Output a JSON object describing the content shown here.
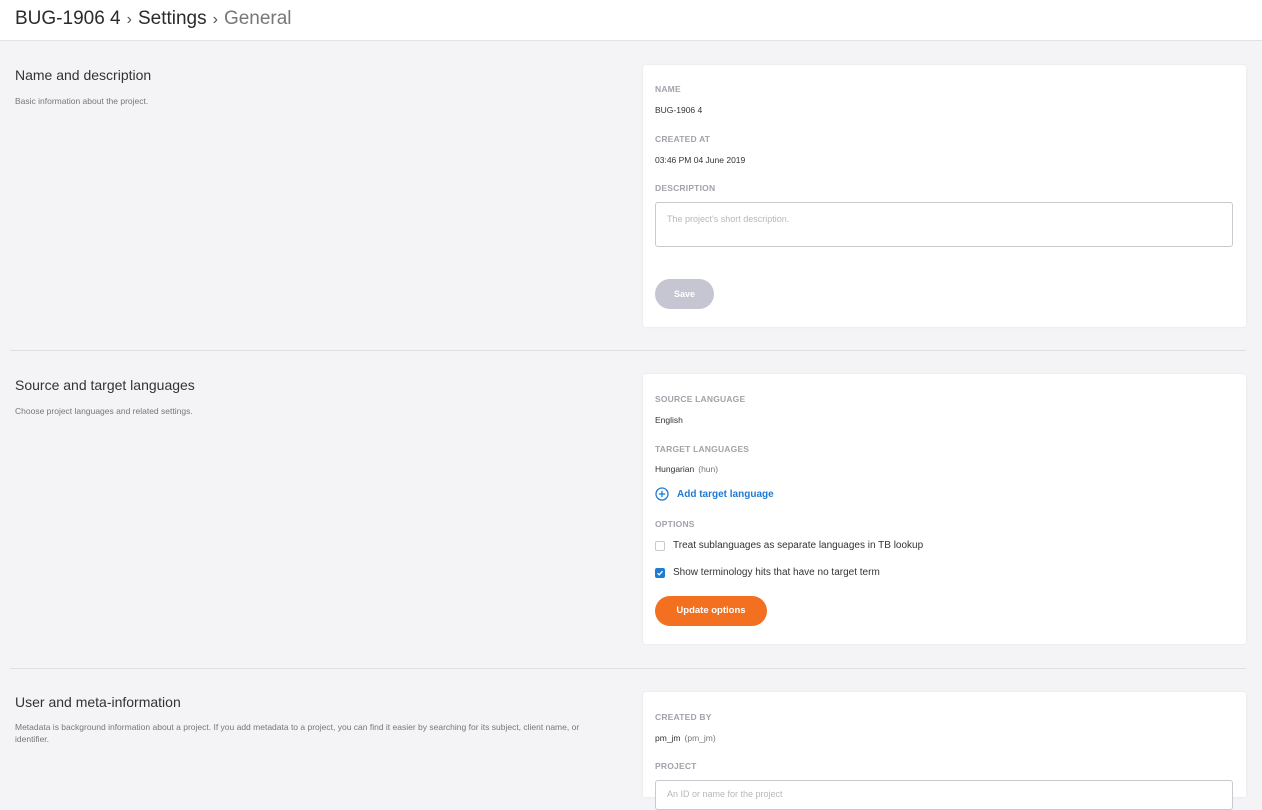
{
  "header": {
    "project": "BUG-1906 4",
    "settings": "Settings",
    "current": "General",
    "separator": "›"
  },
  "sections": {
    "name_description": {
      "title": "Name and description",
      "description": "Basic information about the project.",
      "name_label": "NAME",
      "name_value": "BUG-1906 4",
      "created_at_label": "CREATED AT",
      "created_at_value": "03:46 PM 04 June 2019",
      "description_label": "DESCRIPTION",
      "description_placeholder": "The project's short description.",
      "save_label": "Save"
    },
    "languages": {
      "title": "Source and target languages",
      "description": "Choose project languages and related settings.",
      "source_label": "SOURCE LANGUAGE",
      "source_value": "English",
      "target_label": "TARGET LANGUAGES",
      "target_value": "Hungarian",
      "target_code": "(hun)",
      "add_target_label": "Add target language",
      "options_label": "OPTIONS",
      "options": [
        {
          "label": "Treat sublanguages as separate languages in TB lookup",
          "checked": false
        },
        {
          "label": "Show terminology hits that have no target term",
          "checked": true
        }
      ],
      "update_label": "Update options"
    },
    "user_meta": {
      "title": "User and meta-information",
      "description": "Metadata is background information about a project. If you add metadata to a project, you can find it easier by searching for its subject, client name, or identifier.",
      "created_by_label": "CREATED BY",
      "created_by_value": "pm_jm",
      "created_by_user": "(pm_jm)",
      "project_label": "PROJECT",
      "project_placeholder": "An ID or name for the project"
    }
  },
  "colors": {
    "accent_blue": "#1f7bd4",
    "accent_orange": "#f37021",
    "disabled_button": "#c6c6d3"
  },
  "icons": {
    "add": "plus-circle-icon",
    "check": "check-icon"
  }
}
